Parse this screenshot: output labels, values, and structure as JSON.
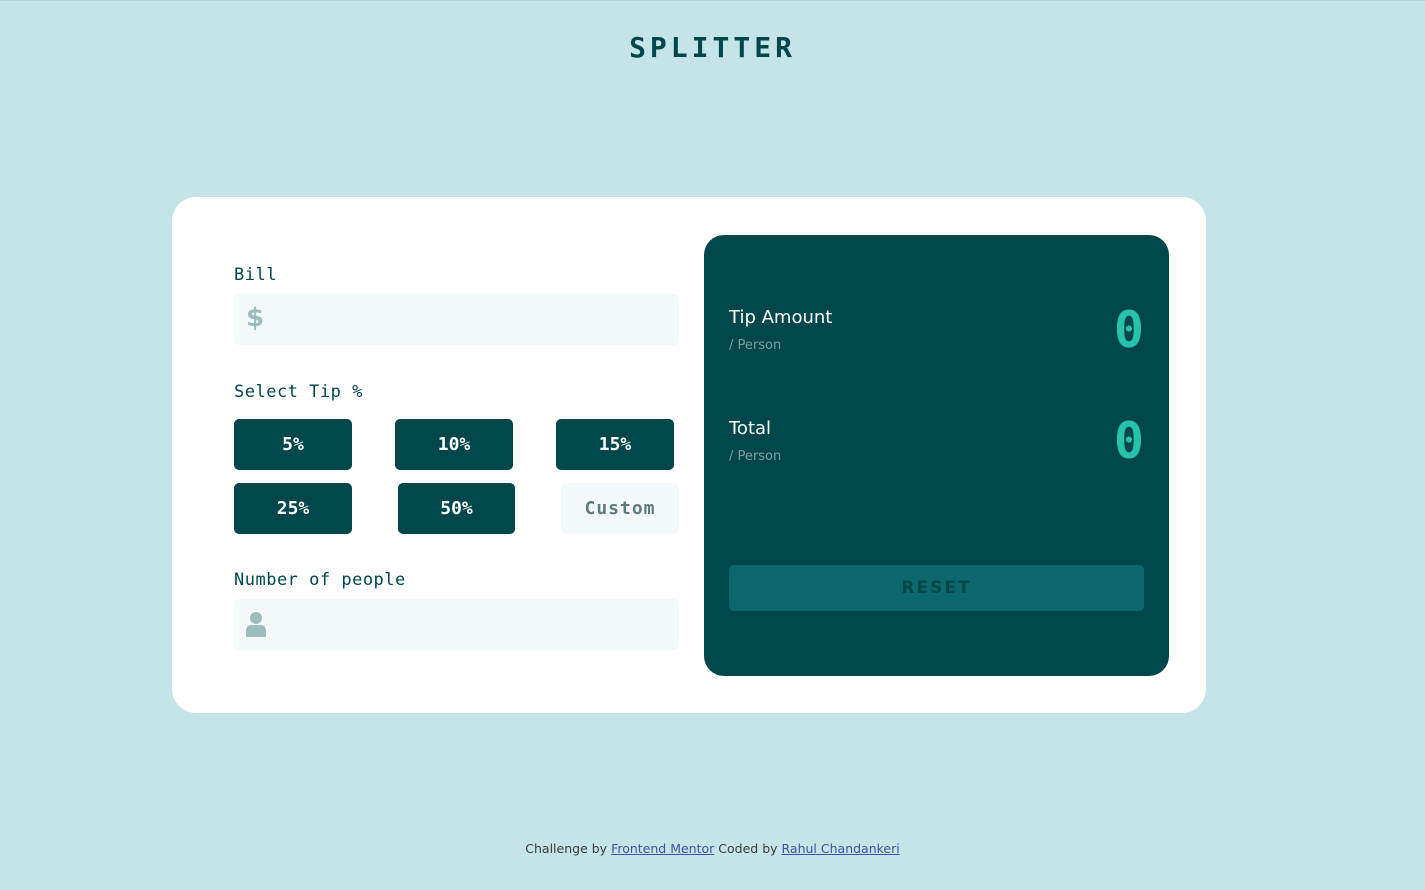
{
  "header": {
    "title": "SPLITTER"
  },
  "form": {
    "bill_label": "Bill",
    "bill_icon": "$",
    "bill_value": "",
    "tip_label": "Select Tip %",
    "tip_options": [
      "5%",
      "10%",
      "15%",
      "25%",
      "50%"
    ],
    "custom_placeholder": "Custom",
    "people_label": "Number of people",
    "people_value": ""
  },
  "results": {
    "tip_amount_label": "Tip Amount",
    "tip_amount_sub": "/ Person",
    "tip_amount_value": "0",
    "total_label": "Total",
    "total_sub": "/ Person",
    "total_value": "0",
    "reset_label": "RESET"
  },
  "footer": {
    "challenge_prefix": "Challenge by",
    "challenge_link": "Frontend Mentor",
    "coded_prefix": "Coded by",
    "coded_link": "Rahul Chandankeri"
  },
  "colors": {
    "background": "#c5e4e7",
    "dark_cyan": "#00474b",
    "accent_cyan": "#26c2ad",
    "input_bg": "#f3f9fa",
    "reset_bg": "#0d686d"
  }
}
